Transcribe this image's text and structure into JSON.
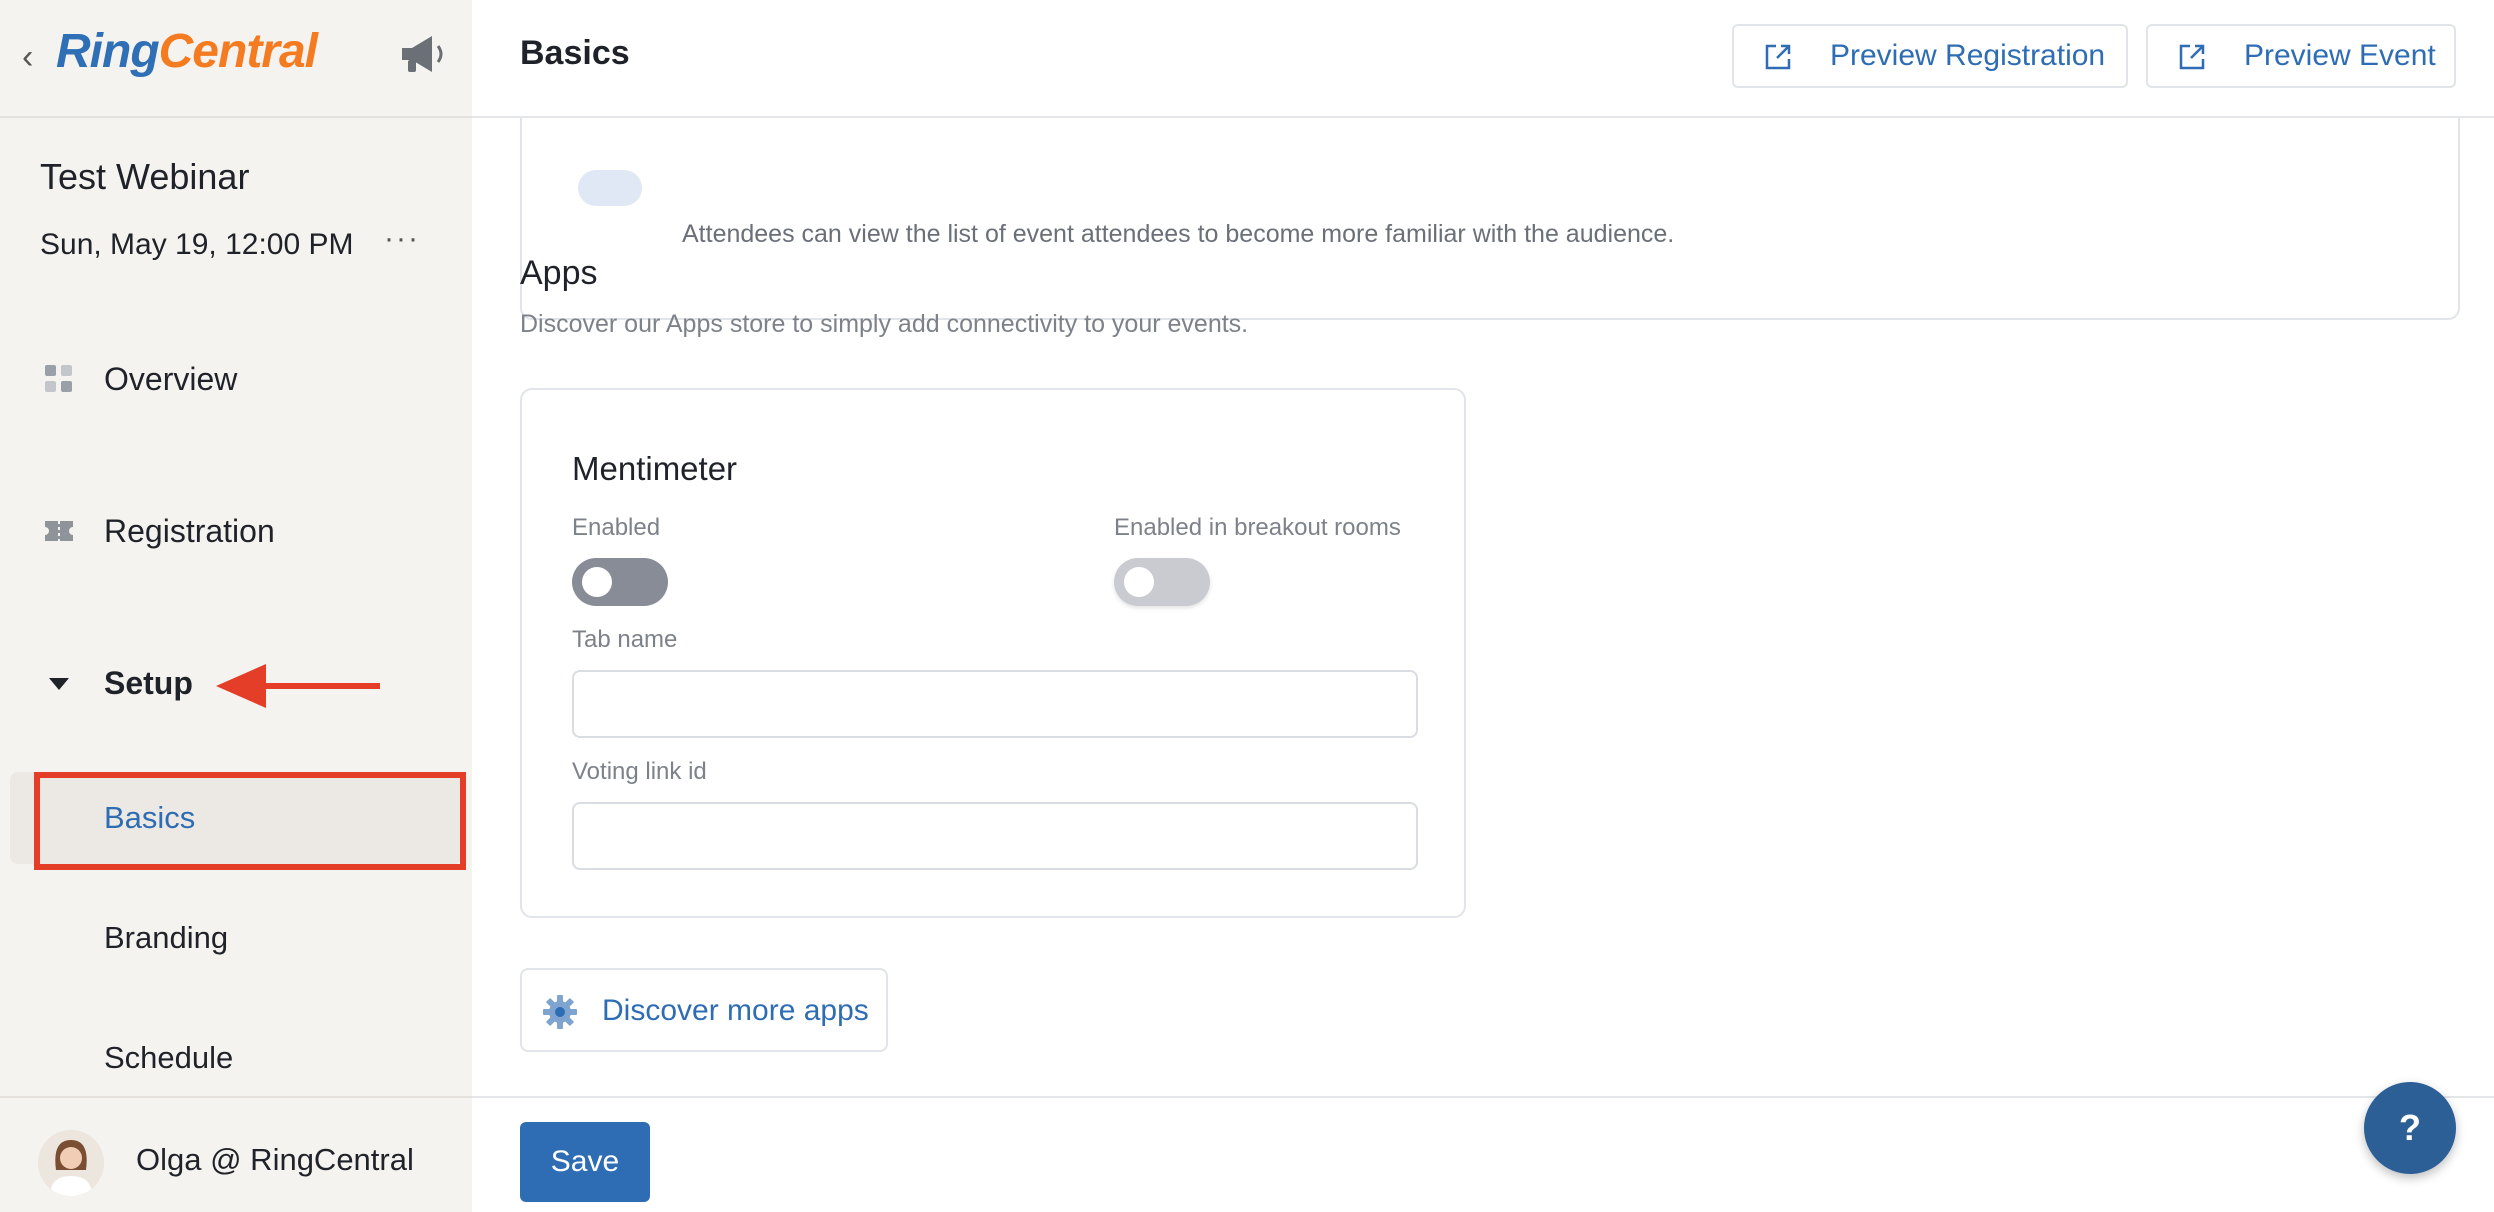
{
  "sidebar": {
    "back_glyph": "‹",
    "logo": {
      "ring": "Ring",
      "central": "Central"
    },
    "event_title": "Test Webinar",
    "event_date": "Sun, May 19, 12:00 PM",
    "more_glyph": "···",
    "nav": {
      "overview": "Overview",
      "registration": "Registration",
      "setup": "Setup"
    },
    "setup_items": {
      "basics": "Basics",
      "branding": "Branding",
      "schedule": "Schedule"
    },
    "user_name": "Olga @ RingCentral"
  },
  "header": {
    "title": "Basics",
    "preview_registration": "Preview Registration",
    "preview_event": "Preview Event"
  },
  "content": {
    "attendee_list_desc": "Attendees can view the list of event attendees to become more familiar with the audience.",
    "apps_title": "Apps",
    "apps_subtitle": "Discover our Apps store to simply add connectivity to your events.",
    "app": {
      "name": "Mentimeter",
      "enabled_label": "Enabled",
      "enabled_value": false,
      "breakout_label": "Enabled in breakout rooms",
      "breakout_value": false,
      "tab_name_label": "Tab name",
      "tab_name_value": "",
      "voting_label": "Voting link id",
      "voting_value": ""
    },
    "discover_more": "Discover more apps"
  },
  "footer": {
    "save": "Save"
  },
  "help": "?",
  "colors": {
    "accent": "#2e6db4",
    "annotation_red": "#e43d28",
    "logo_blue": "#2f6fb5",
    "logo_orange": "#f47b20"
  }
}
